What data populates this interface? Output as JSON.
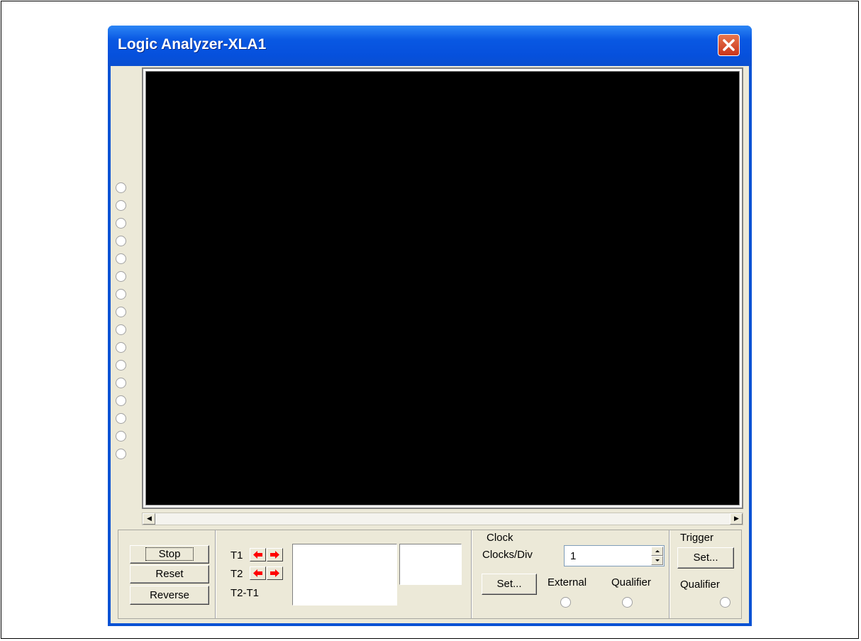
{
  "window": {
    "title": "Logic Analyzer-XLA1"
  },
  "controls": {
    "stop_label": "Stop",
    "reset_label": "Reset",
    "reverse_label": "Reverse"
  },
  "cursors": {
    "t1_label": "T1",
    "t2_label": "T2",
    "t2_t1_label": "T2-T1"
  },
  "clock": {
    "group_title": "Clock",
    "clocks_per_div_label": "Clocks/Div",
    "clocks_per_div_value": "1",
    "set_label": "Set...",
    "external_label": "External",
    "qualifier_label": "Qualifier"
  },
  "trigger": {
    "group_title": "Trigger",
    "set_label": "Set...",
    "qualifier_label": "Qualifier"
  },
  "colors": {
    "titlebar": "#0a52d4",
    "display": "#000000",
    "arrow": "#ff0000",
    "panel": "#ece9d8"
  }
}
